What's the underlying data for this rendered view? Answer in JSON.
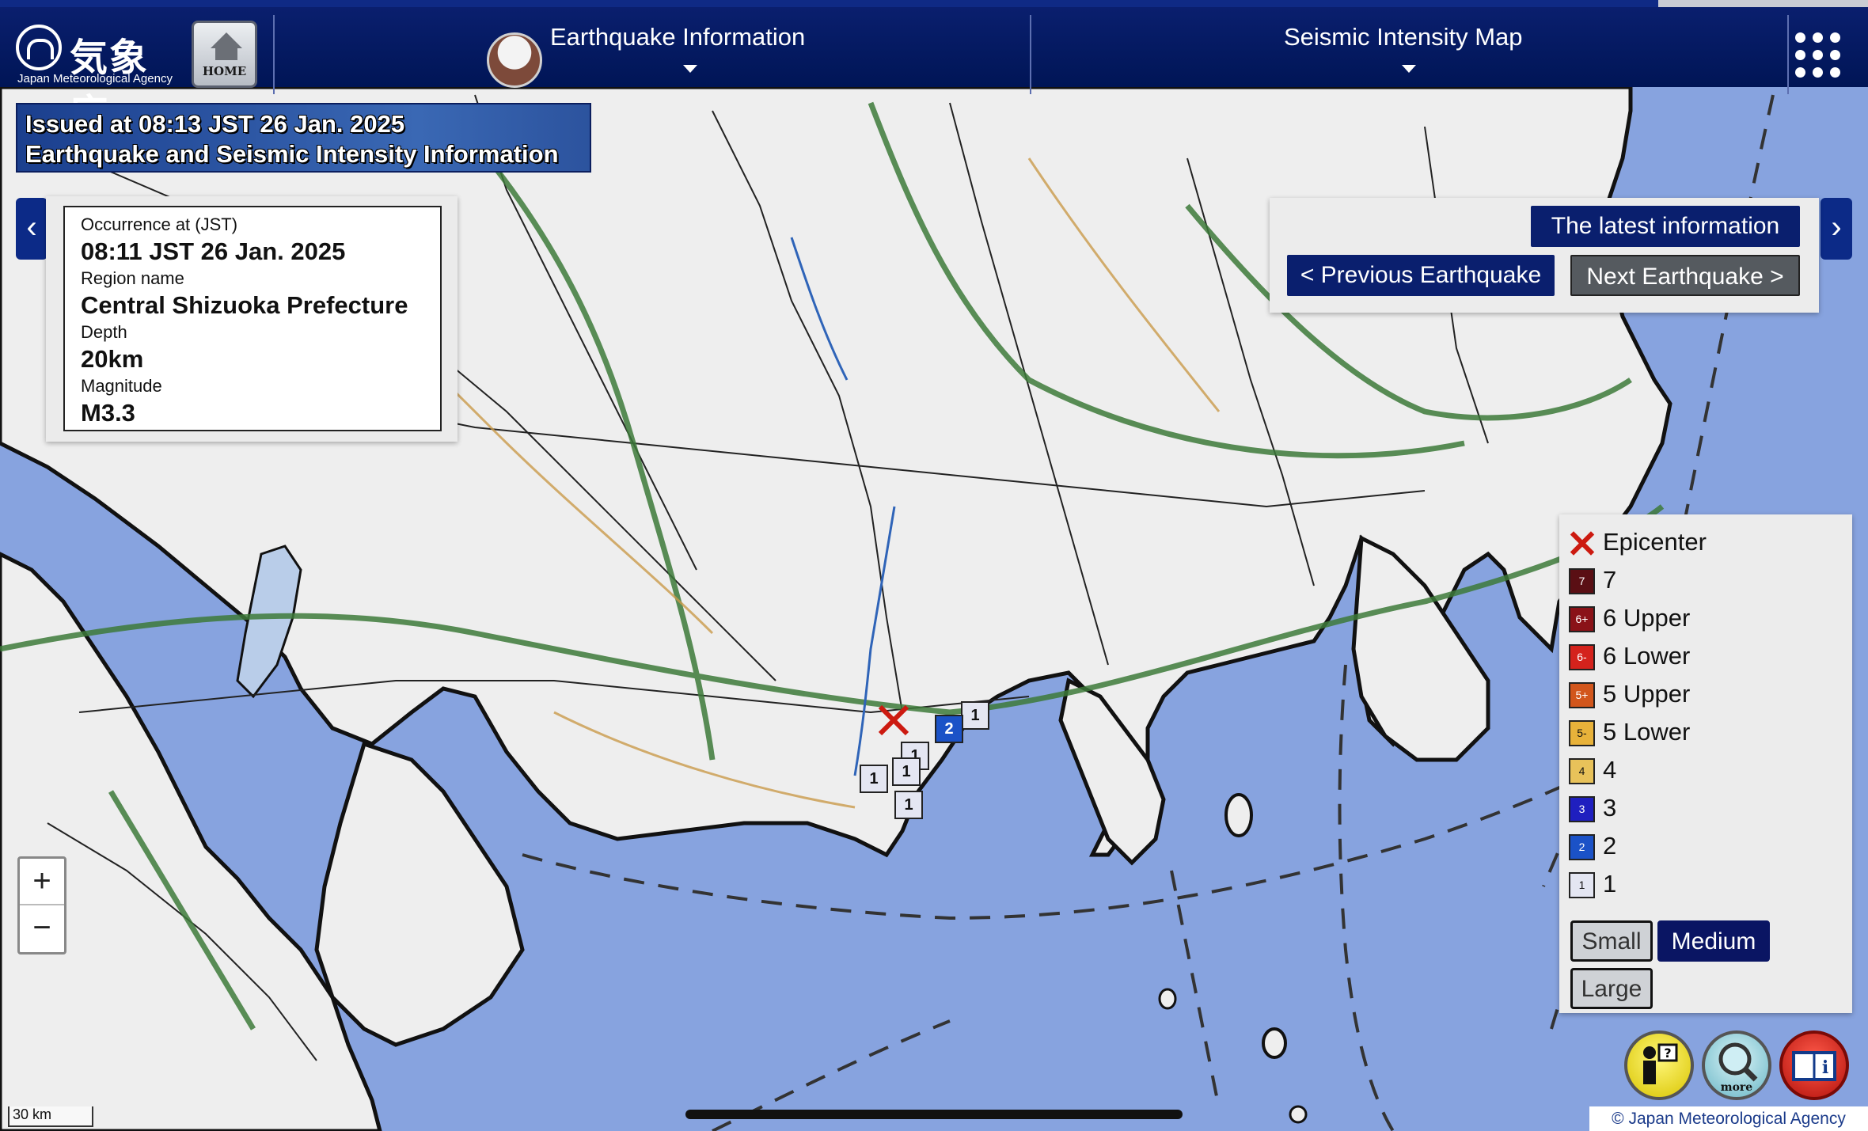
{
  "header": {
    "logo_jp": "気象庁",
    "logo_en": "Japan Meteorological Agency",
    "home_label": "HOME",
    "menu1": "Earthquake Information",
    "menu2": "Seismic Intensity Map",
    "grid_menu_icon": "apps-grid-icon"
  },
  "banner": {
    "line1": "Issued at 08:13 JST 26 Jan. 2025",
    "line2": "Earthquake and Seismic Intensity Information"
  },
  "info": {
    "occurrence_label": "Occurrence at (JST)",
    "occurrence": "08:11 JST 26 Jan. 2025",
    "region_label": "Region name",
    "region": "Central Shizuoka Prefecture",
    "depth_label": "Depth",
    "depth": "20km",
    "magnitude_label": "Magnitude",
    "magnitude": "M3.3"
  },
  "nav": {
    "latest": "The latest information",
    "previous": "< Previous Earthquake",
    "next": "Next Earthquake >",
    "left_arrow": "‹",
    "right_arrow": "›"
  },
  "legend": {
    "epicenter": "Epicenter",
    "items": [
      {
        "code": "7",
        "label": "7",
        "color": "#5a0f14"
      },
      {
        "code": "6+",
        "label": "6 Upper",
        "color": "#8a1218"
      },
      {
        "code": "6-",
        "label": "6 Lower",
        "color": "#d4221c"
      },
      {
        "code": "5+",
        "label": "5 Upper",
        "color": "#d2561c"
      },
      {
        "code": "5-",
        "label": "5 Lower",
        "color": "#e8b23a"
      },
      {
        "code": "4",
        "label": "4",
        "color": "#e8c25a"
      },
      {
        "code": "3",
        "label": "3",
        "color": "#1f1fbf"
      },
      {
        "code": "2",
        "label": "2",
        "color": "#1b52c7"
      },
      {
        "code": "1",
        "label": "1",
        "color": "#e4e6f2"
      }
    ],
    "size_small": "Small",
    "size_medium": "Medium",
    "size_large": "Large",
    "selected_size": "Medium"
  },
  "map": {
    "zoom_in": "+",
    "zoom_out": "−",
    "scale": "30 km",
    "copyright": "© Japan Meteorological Agency",
    "stations": [
      "2",
      "1",
      "1",
      "1",
      "1",
      "1",
      "1"
    ]
  },
  "bottom_buttons": {
    "help_icon": "help-person-icon",
    "more_label": "more",
    "info_icon": "info-book-icon"
  }
}
